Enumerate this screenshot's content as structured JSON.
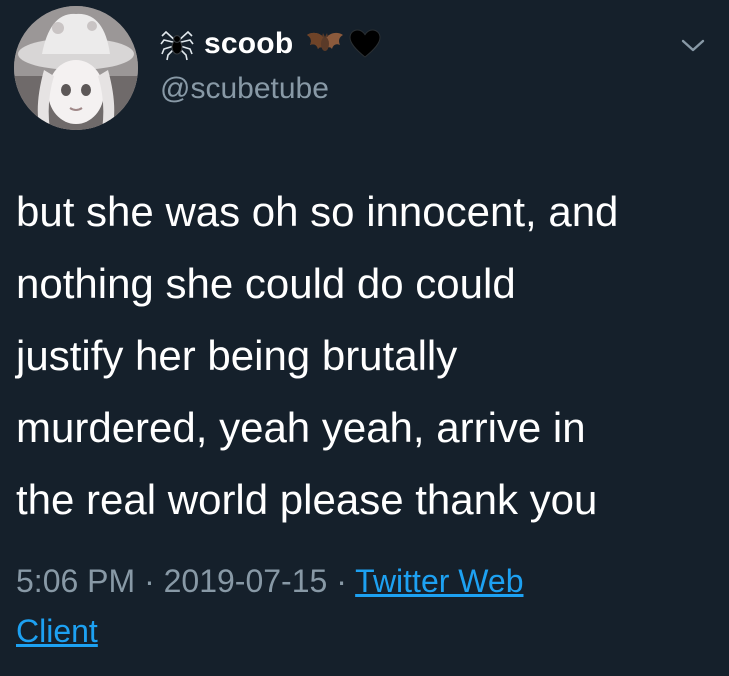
{
  "user": {
    "display_name": "scoob",
    "handle": "@scubetube",
    "name_emojis": [
      "spider-icon",
      "bat-icon",
      "black-heart-icon"
    ]
  },
  "tweet": {
    "lines": [
      "but she was oh so innocent, and",
      "nothing she could do could",
      "justify her being brutally",
      "murdered, yeah yeah, arrive in",
      "the real world please thank you"
    ],
    "time": "5:06 PM",
    "separator": "·",
    "date": "2019-07-15",
    "source_line1": "Twitter Web",
    "source_line2": "Client"
  },
  "colors": {
    "background": "#15202b",
    "primary_text": "#ffffff",
    "secondary_text": "#8899a6",
    "link": "#1da1f2"
  }
}
